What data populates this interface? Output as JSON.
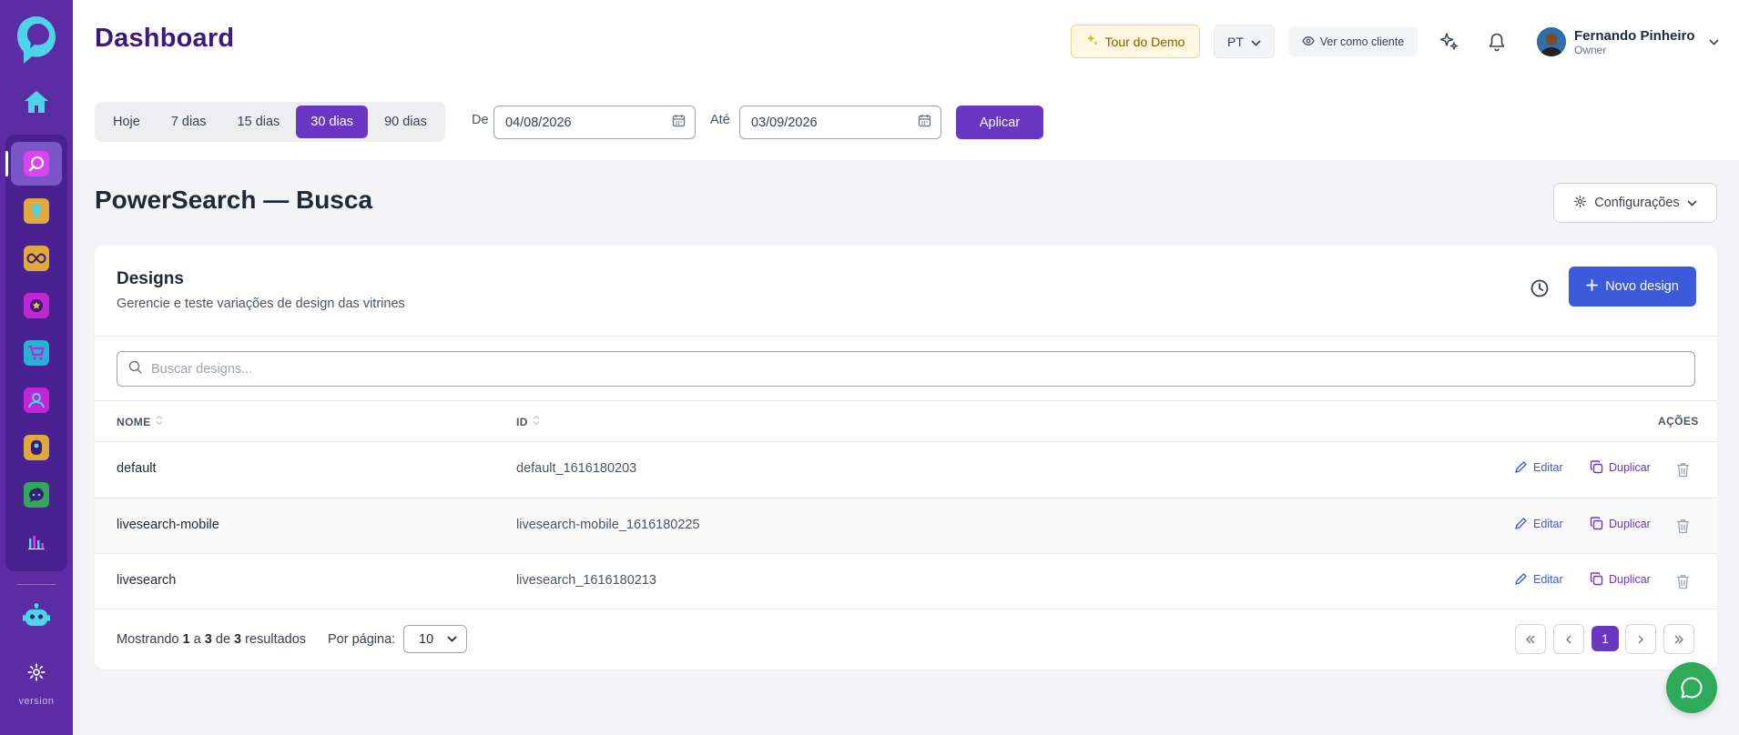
{
  "sidebar": {
    "version_label": "version",
    "apps": [
      {
        "name": "powersearch",
        "color": "#d946ef"
      },
      {
        "name": "ideas",
        "color": "#e0a93b"
      },
      {
        "name": "loop",
        "color": "#e0a93b"
      },
      {
        "name": "badge",
        "color": "#c026d3"
      },
      {
        "name": "cart",
        "color": "#22b3d6"
      },
      {
        "name": "people",
        "color": "#c026d3"
      },
      {
        "name": "tag",
        "color": "#e0a93b"
      },
      {
        "name": "chat",
        "color": "#2eaa5a"
      },
      {
        "name": "analytics",
        "color": "#5b2ca3"
      }
    ]
  },
  "header": {
    "title": "Dashboard",
    "tour_label": "Tour do Demo",
    "lang_label": "PT",
    "client_label": "Ver como cliente",
    "user_name": "Fernando Pinheiro",
    "user_role": "Owner"
  },
  "date_filter": {
    "ranges": [
      "Hoje",
      "7 dias",
      "15 dias",
      "30 dias",
      "90 dias"
    ],
    "active_range": "30 dias",
    "from_label": "De",
    "from_value": "04/08/2026",
    "to_label": "Até",
    "to_value": "03/09/2026",
    "apply_label": "Aplicar"
  },
  "section": {
    "title": "PowerSearch — Busca",
    "config_label": "Configurações"
  },
  "card": {
    "title": "Designs",
    "subtitle": "Gerencie e teste variações de design das vitrines",
    "new_label": "Novo design",
    "search_placeholder": "Buscar designs...",
    "columns": {
      "name": "NOME",
      "id": "ID",
      "actions": "AÇÕES"
    },
    "rows": [
      {
        "name": "default",
        "id": "default_1616180203"
      },
      {
        "name": "livesearch-mobile",
        "id": "livesearch-mobile_1616180225"
      },
      {
        "name": "livesearch",
        "id": "livesearch_1616180213"
      }
    ],
    "edit_label": "Editar",
    "duplicate_label": "Duplicar",
    "footer": {
      "showing": "Mostrando",
      "from": "1",
      "a": "a",
      "to": "3",
      "de": "de",
      "total": "3",
      "results": "resultados",
      "per_page_label": "Por página:",
      "per_page_value": "10",
      "current_page": "1"
    }
  },
  "colors": {
    "brand": "#5b2ca3",
    "accent": "#6a36c4",
    "primary_button": "#3b5bdb",
    "chat": "#2eaa5a"
  }
}
